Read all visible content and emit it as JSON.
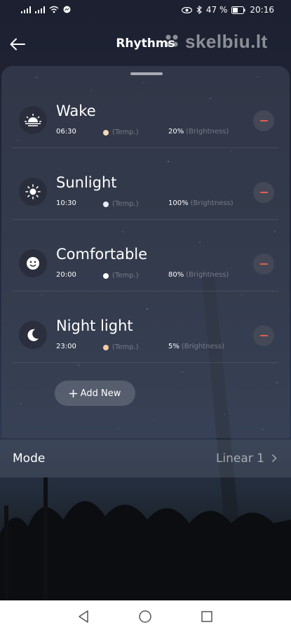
{
  "status_bar": {
    "battery_percent": "47 %",
    "time": "20:16",
    "icons": [
      "signal-icon",
      "signal-icon",
      "wifi-icon",
      "messenger-icon",
      "eye-icon",
      "bluetooth-icon",
      "battery-icon"
    ]
  },
  "header": {
    "title": "Rhythms",
    "back_icon": "arrow-left-icon"
  },
  "watermark": {
    "text": "skelbiu.lt"
  },
  "rhythms": [
    {
      "name": "Wake",
      "time": "06:30",
      "temp_label": "(Temp.)",
      "temp_color": "#f3d9b8",
      "brightness": "20%",
      "brightness_label": "(Brightness)",
      "icon": "sunrise-icon"
    },
    {
      "name": "Sunlight",
      "time": "10:30",
      "temp_label": "(Temp.)",
      "temp_color": "#e8ecfb",
      "brightness": "100%",
      "brightness_label": "(Brightness)",
      "icon": "sun-icon"
    },
    {
      "name": "Comfortable",
      "time": "20:00",
      "temp_label": "(Temp.)",
      "temp_color": "#ffffff",
      "brightness": "80%",
      "brightness_label": "(Brightness)",
      "icon": "smile-icon"
    },
    {
      "name": "Night light",
      "time": "23:00",
      "temp_label": "(Temp.)",
      "temp_color": "#f5caa0",
      "brightness": "5%",
      "brightness_label": "(Brightness)",
      "icon": "moon-icon"
    }
  ],
  "add_button": {
    "label": "Add New",
    "icon": "plus-icon"
  },
  "mode": {
    "label": "Mode",
    "value": "Linear 1",
    "icon": "chevron-right-icon"
  },
  "nav": {
    "icons": [
      "back-triangle-icon",
      "home-circle-icon",
      "recents-square-icon"
    ]
  },
  "colors": {
    "remove_accent": "#e0604f"
  }
}
